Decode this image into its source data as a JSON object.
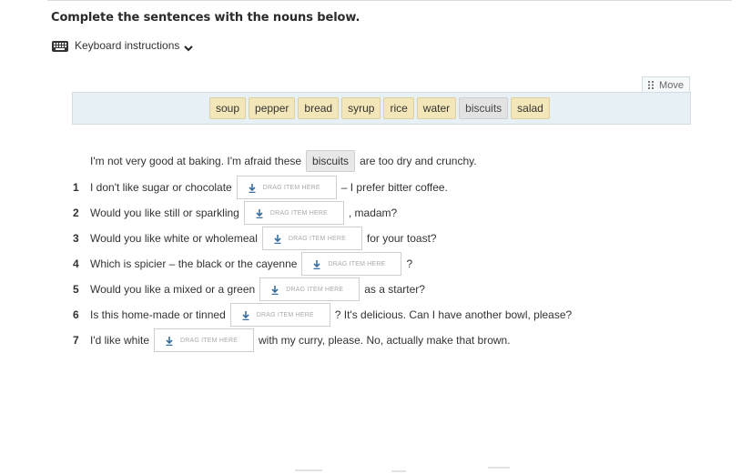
{
  "instruction": "Complete the sentences with the nouns below.",
  "keyboard": {
    "label": "Keyboard instructions",
    "icon": "keyboard-icon",
    "chevron_icon": "chevron-down-icon"
  },
  "word_bank": {
    "move_label": "Move",
    "tiles": [
      {
        "word": "soup",
        "used": false
      },
      {
        "word": "pepper",
        "used": false
      },
      {
        "word": "bread",
        "used": false
      },
      {
        "word": "syrup",
        "used": false
      },
      {
        "word": "rice",
        "used": false
      },
      {
        "word": "water",
        "used": false
      },
      {
        "word": "biscuits",
        "used": true
      },
      {
        "word": "salad",
        "used": false
      }
    ]
  },
  "drop_placeholder": "DRAG ITEM HERE",
  "example": {
    "before": "I'm not very good at baking. I'm afraid these",
    "answer": "biscuits",
    "after": "are too dry and crunchy."
  },
  "questions": [
    {
      "num": "1",
      "before": "I don't like sugar or chocolate",
      "after": "– I prefer bitter coffee."
    },
    {
      "num": "2",
      "before": "Would you like still or sparkling",
      "after": ", madam?"
    },
    {
      "num": "3",
      "before": "Would you like white or wholemeal",
      "after": "for your toast?"
    },
    {
      "num": "4",
      "before": "Which is spicier – the black or the cayenne",
      "after": "?"
    },
    {
      "num": "5",
      "before": "Would you like a mixed or a green",
      "after": "as a starter?"
    },
    {
      "num": "6",
      "before": "Is this home-made or tinned",
      "after": "? It's delicious. Can I have another bowl, please?"
    },
    {
      "num": "7",
      "before": "I'd like white",
      "after": "with my curry, please. No, actually make that brown."
    }
  ]
}
